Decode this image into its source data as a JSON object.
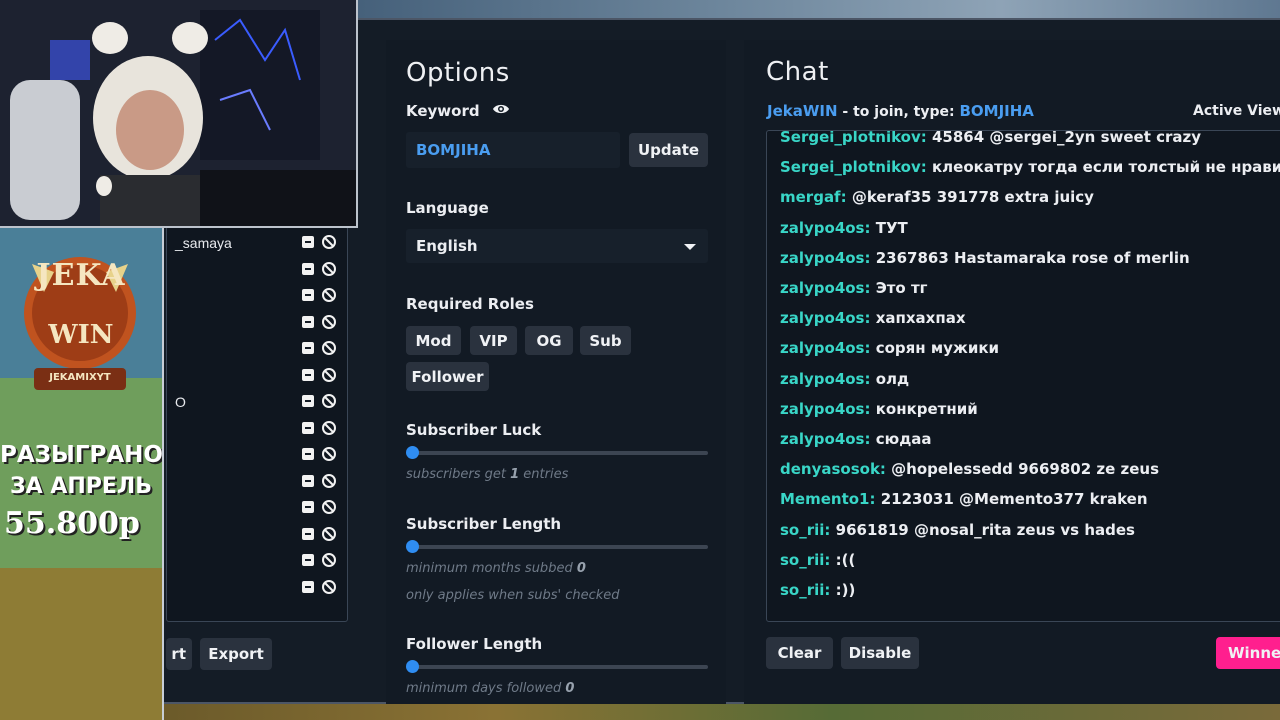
{
  "list_panel": {
    "rows": [
      {
        "name": "_samaya"
      },
      {
        "name": ""
      },
      {
        "name": ""
      },
      {
        "name": ""
      },
      {
        "name": ""
      },
      {
        "name": ""
      },
      {
        "name": "O"
      },
      {
        "name": ""
      },
      {
        "name": ""
      },
      {
        "name": ""
      },
      {
        "name": ""
      },
      {
        "name": ""
      },
      {
        "name": ""
      },
      {
        "name": ""
      }
    ],
    "import_label_partial": "rt",
    "export_label": "Export"
  },
  "options": {
    "title": "Options",
    "keyword_label": "Keyword",
    "keyword_value": "BOMJIHA",
    "update_label": "Update",
    "language_label": "Language",
    "language_value": "English",
    "required_roles_label": "Required Roles",
    "roles": [
      "Mod",
      "VIP",
      "OG",
      "Sub",
      "Follower"
    ],
    "subscriber_luck_label": "Subscriber Luck",
    "subscriber_luck_hint_pre": "subscribers get ",
    "subscriber_luck_value": "1",
    "subscriber_luck_hint_post": " entries",
    "subscriber_length_label": "Subscriber Length",
    "subscriber_length_hint_pre": "minimum months subbed ",
    "subscriber_length_value": "0",
    "subscriber_length_note": "only applies when subs' checked",
    "follower_length_label": "Follower Length",
    "follower_length_hint_pre": "minimum days followed ",
    "follower_length_value": "0",
    "sliders": {
      "subscriber_luck": 0,
      "subscriber_length": 0,
      "follower_length": 0
    }
  },
  "chat": {
    "title": "Chat",
    "host_user": "JekaWIN",
    "join_text": " - to join, type: ",
    "join_keyword": "BOMJIHA",
    "active_viewers_label": "Active View",
    "messages": [
      {
        "user": "Sergei_plotnikov:",
        "text": "45864 @sergei_2yn sweet crazy"
      },
      {
        "user": "Sergei_plotnikov:",
        "text": "клеокатру тогда если толстый не нравится"
      },
      {
        "user": "mergaf:",
        "text": "@keraf35 391778 extra juicy"
      },
      {
        "user": "zalypo4os:",
        "text": "ТУТ"
      },
      {
        "user": "zalypo4os:",
        "text": "2367863 Hastamaraka rose of merlin"
      },
      {
        "user": "zalypo4os:",
        "text": "Это тг"
      },
      {
        "user": "zalypo4os:",
        "text": "хапхахпах"
      },
      {
        "user": "zalypo4os:",
        "text": "сорян мужики"
      },
      {
        "user": "zalypo4os:",
        "text": "олд"
      },
      {
        "user": "zalypo4os:",
        "text": "конкретний"
      },
      {
        "user": "zalypo4os:",
        "text": "сюдаа"
      },
      {
        "user": "denyasosok:",
        "text": "@hopelessedd 9669802 ze zeus"
      },
      {
        "user": "Memento1:",
        "text": "2123031 @Memento377 kraken"
      },
      {
        "user": "so_rii:",
        "text": "9661819 @nosal_rita zeus vs hades"
      },
      {
        "user": "so_rii:",
        "text": ":(("
      },
      {
        "user": "so_rii:",
        "text": ":))"
      }
    ],
    "clear_label": "Clear",
    "disable_label": "Disable",
    "winner_label": "Winner"
  },
  "promo": {
    "logo_top": "JEKA",
    "logo_bottom": "WIN",
    "logo_ribbon": "JEKAMIXYT",
    "line1": "РАЗЫГРАНО",
    "line2": "ЗА АПРЕЛЬ",
    "amount": "55.800р"
  },
  "colors": {
    "accent_blue": "#2f8df2",
    "username_teal": "#39d6c7",
    "winner_pink": "#ff1f8e"
  }
}
